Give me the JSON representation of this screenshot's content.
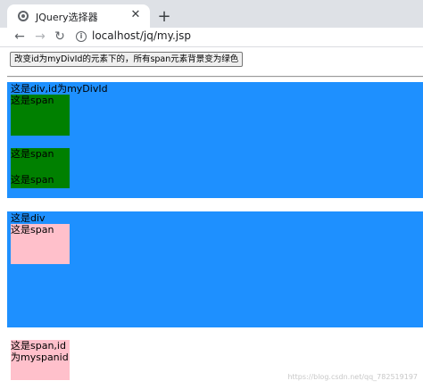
{
  "browser": {
    "tab_title": "JQuery选择器",
    "tab_close": "✕",
    "new_tab": "+",
    "nav_back": "←",
    "nav_forward": "→",
    "nav_reload": "↻",
    "info_glyph": "i",
    "url": "localhost/jq/my.jsp"
  },
  "page": {
    "button_label": "改变id为myDivId的元素下的，所有span元素背景变为绿色",
    "div1": {
      "text": "这是div,id为myDivId",
      "spans": [
        "这是span",
        "这是span",
        "这是span"
      ]
    },
    "div2": {
      "text": "这是div",
      "span": "这是span"
    },
    "myspan": {
      "line1": "这是span,id",
      "line2": "为myspanid"
    },
    "watermark": "https://blog.csdn.net/qq_782519197"
  },
  "colors": {
    "div_background": "#1e90ff",
    "span_green": "#008000",
    "span_pink": "#ffc0cb"
  }
}
